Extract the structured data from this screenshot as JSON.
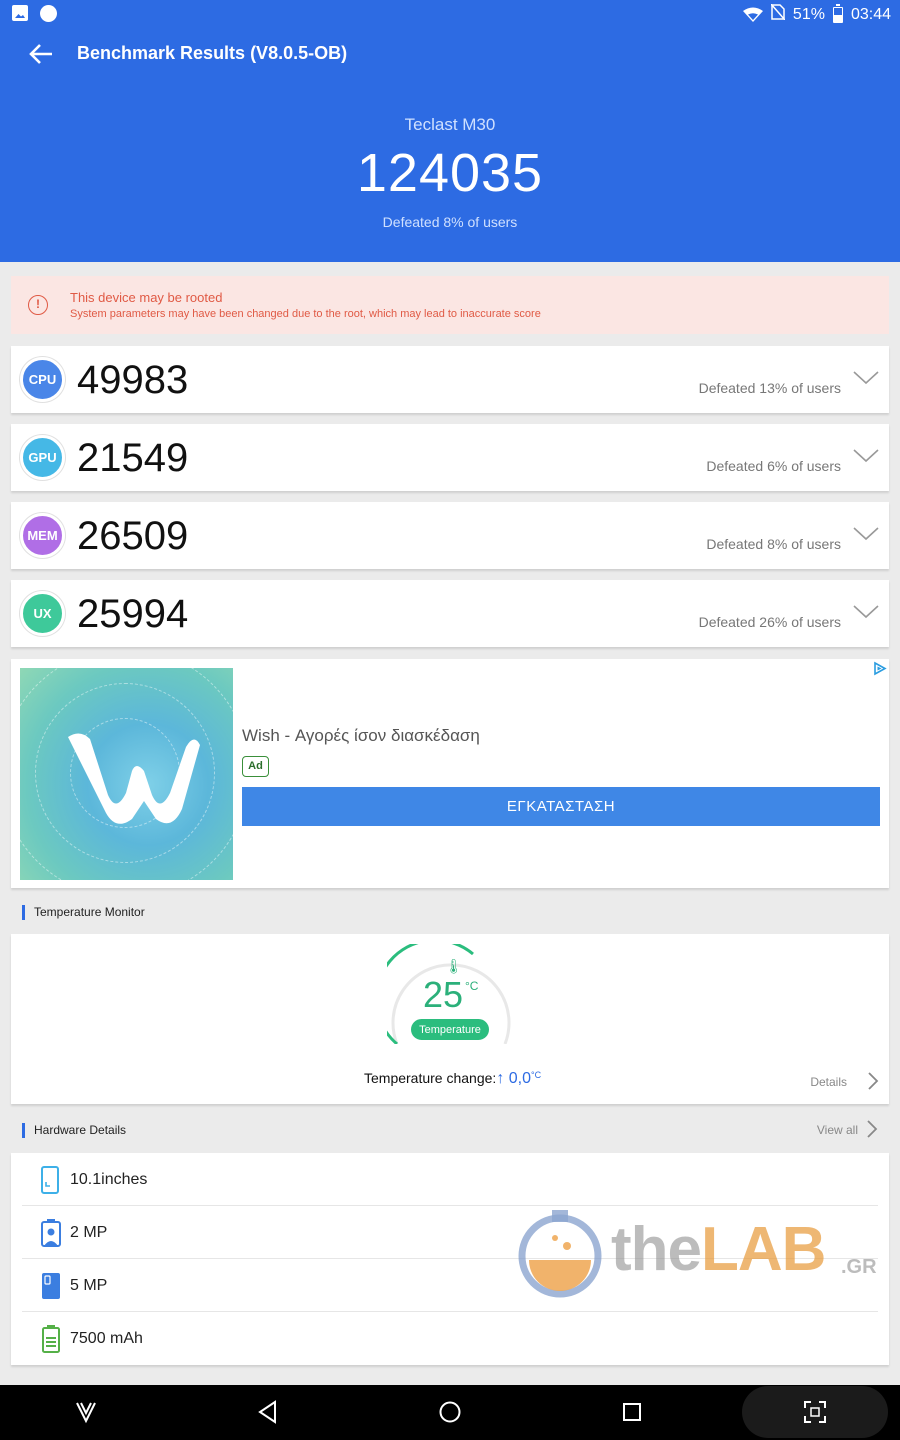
{
  "status_bar": {
    "battery": "51%",
    "time": "03:44"
  },
  "header": {
    "title": "Benchmark Results (V8.0.5-OB)",
    "device": "Teclast M30",
    "total_score": "124035",
    "defeated": "Defeated 8% of users"
  },
  "warning": {
    "title": "This device may be rooted",
    "subtitle": "System parameters may have been changed due to the root, which may lead to inaccurate score"
  },
  "scores": [
    {
      "label": "CPU",
      "value": "49983",
      "defeated": "Defeated 13% of users",
      "color": "#4a86e8"
    },
    {
      "label": "GPU",
      "value": "21549",
      "defeated": "Defeated 6% of users",
      "color": "#45b8e6"
    },
    {
      "label": "MEM",
      "value": "26509",
      "defeated": "Defeated 8% of users",
      "color": "#b06ee6"
    },
    {
      "label": "UX",
      "value": "25994",
      "defeated": "Defeated 26% of users",
      "color": "#3ec99a"
    }
  ],
  "ad": {
    "title": "Wish - Αγορές ίσον διασκέδαση",
    "tag": "Ad",
    "button": "ΕΓΚΑΤΑΣΤΑΣΗ"
  },
  "temperature": {
    "section_title": "Temperature Monitor",
    "value": "25",
    "unit": "°C",
    "pill": "Temperature",
    "change_label": "Temperature change:",
    "change_value": "↑ 0,0",
    "change_unit": "°C",
    "details": "Details"
  },
  "hardware": {
    "section_title": "Hardware Details",
    "view_all": "View all",
    "items": [
      {
        "text": "10.1inches",
        "icon": "screen-icon"
      },
      {
        "text": "2 MP",
        "icon": "front-camera-icon"
      },
      {
        "text": "5 MP",
        "icon": "rear-camera-icon"
      },
      {
        "text": "7500 mAh",
        "icon": "battery-icon"
      }
    ]
  },
  "watermark": {
    "brand": "the",
    "brand_accent": "LAB",
    "suffix": ".GR"
  }
}
